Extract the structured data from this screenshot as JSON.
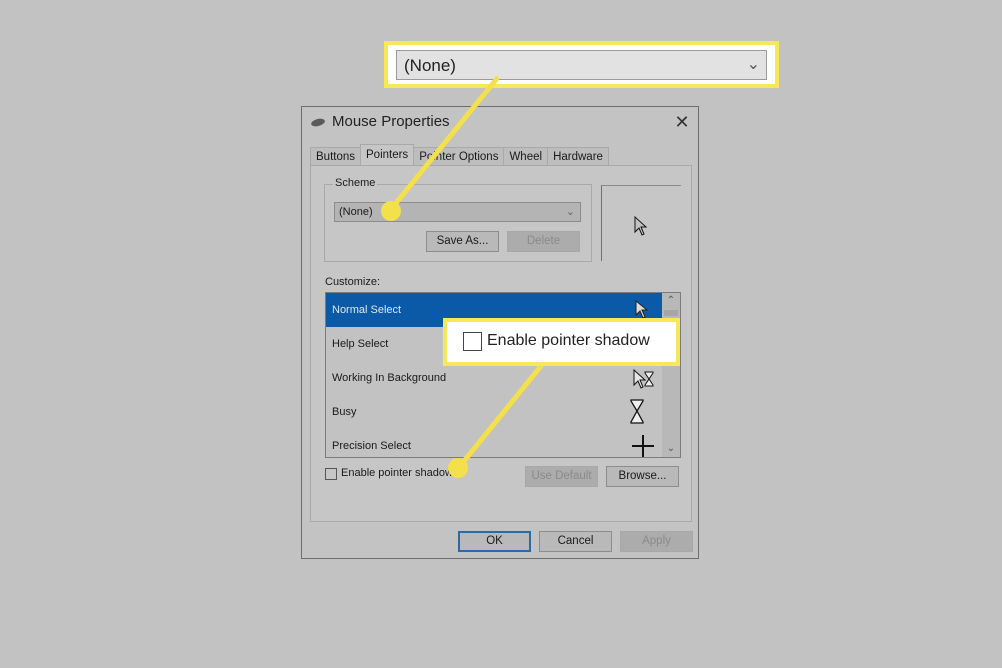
{
  "window": {
    "title": "Mouse Properties",
    "close_icon": "close-icon"
  },
  "tabs": [
    {
      "label": "Buttons",
      "active": false
    },
    {
      "label": "Pointers",
      "active": true
    },
    {
      "label": "Pointer Options",
      "active": false
    },
    {
      "label": "Wheel",
      "active": false
    },
    {
      "label": "Hardware",
      "active": false
    }
  ],
  "scheme": {
    "group_label": "Scheme",
    "selected": "(None)",
    "save_as_label": "Save As...",
    "delete_label": "Delete"
  },
  "customize": {
    "label": "Customize:",
    "items": [
      {
        "label": "Normal Select",
        "icon": "arrow-pointer-icon",
        "selected": true
      },
      {
        "label": "Help Select",
        "icon": "help-pointer-icon",
        "selected": false
      },
      {
        "label": "Working In Background",
        "icon": "working-pointer-icon",
        "selected": false
      },
      {
        "label": "Busy",
        "icon": "hourglass-icon",
        "selected": false
      },
      {
        "label": "Precision Select",
        "icon": "crosshair-icon",
        "selected": false
      }
    ]
  },
  "shadow_checkbox": {
    "label": "Enable pointer shadow",
    "checked": false
  },
  "use_default_label": "Use Default",
  "browse_label": "Browse...",
  "footer": {
    "ok_label": "OK",
    "cancel_label": "Cancel",
    "apply_label": "Apply"
  },
  "callouts": {
    "scheme_zoom_value": "(None)",
    "shadow_zoom_label": "Enable pointer shadow",
    "highlight_color": "#f4e04a"
  }
}
